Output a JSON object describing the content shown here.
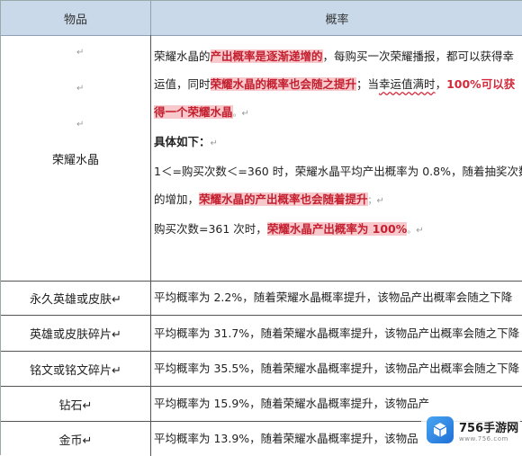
{
  "headers": {
    "item": "物品",
    "rate": "概率"
  },
  "ret_mark": "↵",
  "main_item": {
    "name": "荣耀水晶",
    "lines": [
      {
        "parts": [
          {
            "t": "荣耀水晶的",
            "s": ""
          },
          {
            "t": "产出概率是逐渐递增的",
            "s": "hl"
          },
          {
            "t": "，每购买一次荣耀播报，都可以获得幸",
            "s": ""
          }
        ]
      },
      {
        "parts": [
          {
            "t": "运值，同时",
            "s": ""
          },
          {
            "t": "荣耀水晶的概率也会随之提升",
            "s": "hl"
          },
          {
            "t": "；当",
            "s": ""
          },
          {
            "t": "幸运值满时",
            "s": "und"
          },
          {
            "t": "，",
            "s": ""
          },
          {
            "t": "100%可以获",
            "s": "red"
          }
        ]
      },
      {
        "parts": [
          {
            "t": "得一个荣耀水晶",
            "s": "hl"
          },
          {
            "t": "。↵",
            "s": "ret"
          }
        ]
      },
      {
        "parts": [
          {
            "t": "具体如下：",
            "s": "bold"
          },
          {
            "t": "↵",
            "s": "ret"
          }
        ]
      },
      {
        "parts": [
          {
            "t": "1＜=购买次数＜=360 时，荣耀水晶平均产出概率为 0.8%，随着抽奖次数",
            "s": ""
          }
        ]
      },
      {
        "parts": [
          {
            "t": "的增加，",
            "s": ""
          },
          {
            "t": "荣耀水晶的产出概率也会随着提升",
            "s": "hl"
          },
          {
            "t": "；↵",
            "s": "ret"
          }
        ]
      },
      {
        "parts": [
          {
            "t": "购买次数=361 次时，",
            "s": ""
          },
          {
            "t": "荣耀水晶产出概率为 100%",
            "s": "hl"
          },
          {
            "t": "。↵",
            "s": "ret"
          }
        ]
      }
    ]
  },
  "rows": [
    {
      "item": "永久英雄或皮肤↵",
      "rate": "平均概率为 2.2%，随着荣耀水晶概率提升，该物品产出概率会随之下降"
    },
    {
      "item": "英雄或皮肤碎片↵",
      "rate": "平均概率为 31.7%，随着荣耀水晶概率提升，该物品产出概率会随之下降"
    },
    {
      "item": "铭文或铭文碎片↵",
      "rate": "平均概率为 35.5%，随着荣耀水晶概率提升，该物品产出概率会随之下降"
    },
    {
      "item": "钻石↵",
      "rate": "平均概率为 15.9%，随着荣耀水晶概率提升，该物品产"
    },
    {
      "item": "金币↵",
      "rate": "平均概率为 13.9%，随着荣耀水晶概率提升，该物品"
    }
  ],
  "watermark": {
    "main": "756手游网",
    "sub": "www.756.com"
  }
}
